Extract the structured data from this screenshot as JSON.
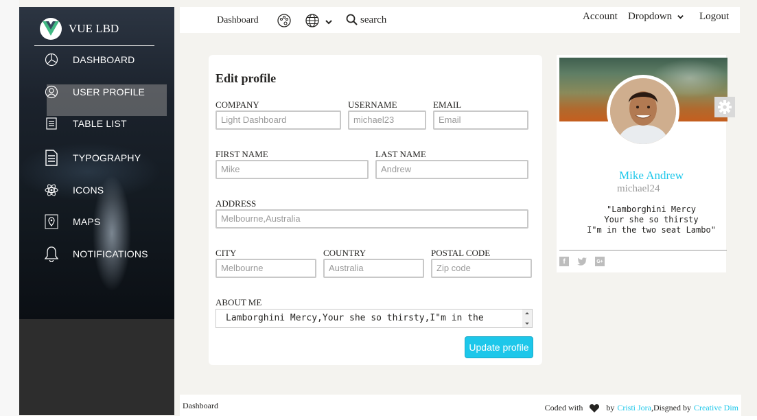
{
  "sidebar": {
    "brand": "VUE LBD",
    "items": [
      {
        "label": "DASHBOARD",
        "icon": "chart-pie-icon"
      },
      {
        "label": "USER PROFILE",
        "icon": "user-circle-icon"
      },
      {
        "label": "TABLE LIST",
        "icon": "notes-icon"
      },
      {
        "label": "TYPOGRAPHY",
        "icon": "document-icon"
      },
      {
        "label": "ICONS",
        "icon": "atom-icon"
      },
      {
        "label": "MAPS",
        "icon": "map-pin-icon"
      },
      {
        "label": "NOTIFICATIONS",
        "icon": "bell-icon"
      }
    ],
    "active_index": 1
  },
  "navbar": {
    "brand": "Dashboard",
    "search_label": "search",
    "account_label": "Account",
    "dropdown_label": "Dropdown",
    "logout_label": "Logout"
  },
  "edit_profile": {
    "title": "Edit profile",
    "company": {
      "label": "COMPANY",
      "value": "Light Dashboard"
    },
    "username": {
      "label": "USERNAME",
      "value": "michael23"
    },
    "email": {
      "label": "EMAIL",
      "placeholder": "Email"
    },
    "first_name": {
      "label": "FIRST NAME",
      "value": "Mike"
    },
    "last_name": {
      "label": "LAST NAME",
      "value": "Andrew"
    },
    "address": {
      "label": "ADDRESS",
      "value": "Melbourne,Australia"
    },
    "city": {
      "label": "CITY",
      "value": "Melbourne"
    },
    "country": {
      "label": "COUNTRY",
      "value": "Australia"
    },
    "postal_code": {
      "label": "POSTAL CODE",
      "placeholder": "Zip code"
    },
    "about_me": {
      "label": "ABOUT ME",
      "value": "Lamborghini Mercy,Your she so thirsty,I\"m in the"
    },
    "update_button": "Update profile"
  },
  "profile_card": {
    "name": "Mike Andrew",
    "username": "michael24",
    "bio_lines": [
      "\"Lamborghini Mercy",
      "Your she so thirsty",
      "I\"m in the two seat Lambo\""
    ],
    "social_icons": [
      "facebook-icon",
      "twitter-icon",
      "google-plus-icon"
    ]
  },
  "footer": {
    "left": "Dashboard",
    "coded_with": "Coded with",
    "by": "by",
    "author": "Cristi Jora",
    "designed_by": ",Disgned by",
    "designer": "Creative Dim"
  },
  "colors": {
    "accent": "#1dc7ea",
    "sidebar": "#2b2b2b",
    "background": "#f4f3ef"
  }
}
